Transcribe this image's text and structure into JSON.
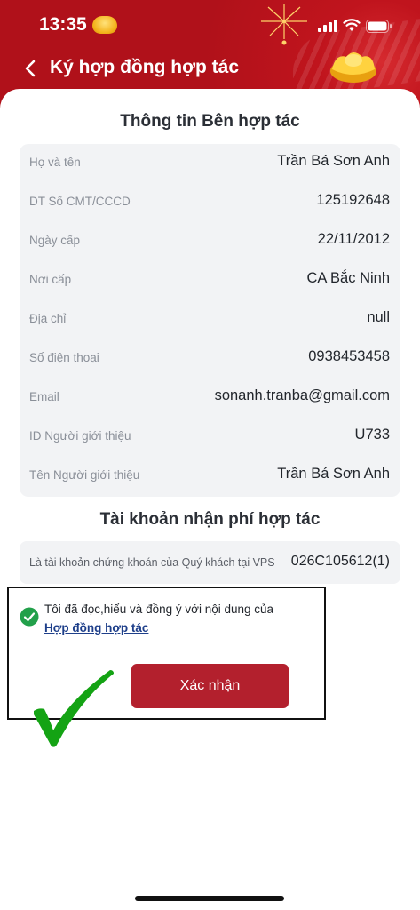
{
  "status_bar": {
    "time": "13:35"
  },
  "nav": {
    "title": "Ký hợp đồng hợp tác"
  },
  "partner_section": {
    "title": "Thông tin Bên hợp tác",
    "rows": [
      {
        "label": "Họ và tên",
        "value": "Trần Bá Sơn Anh"
      },
      {
        "label": "DT Số CMT/CCCD",
        "value": "125192648"
      },
      {
        "label": "Ngày cấp",
        "value": "22/11/2012"
      },
      {
        "label": "Nơi cấp",
        "value": "CA Bắc Ninh"
      },
      {
        "label": "Địa chỉ",
        "value": "null"
      },
      {
        "label": "Số điện thoại",
        "value": "0938453458"
      },
      {
        "label": "Email",
        "value": "sonanh.tranba@gmail.com"
      },
      {
        "label": "ID Người giới thiệu",
        "value": "U733"
      },
      {
        "label": "Tên Người giới thiệu",
        "value": "Trần Bá Sơn Anh"
      }
    ]
  },
  "fee_account_section": {
    "title": "Tài khoản nhận phí hợp tác",
    "label": "Là tài khoản chứng khoán của Quý khách tại VPS",
    "value": "026C105612(1)"
  },
  "agreement": {
    "text": "Tôi đã đọc,hiểu và đồng ý với nội dung của",
    "link": "Hợp đồng hợp tác",
    "checked": true
  },
  "confirm_button": {
    "label": "Xác nhận"
  },
  "colors": {
    "header_red": "#b5121b",
    "button_red": "#b3202d",
    "check_green": "#22a04a",
    "link_blue": "#1e3f8a"
  }
}
